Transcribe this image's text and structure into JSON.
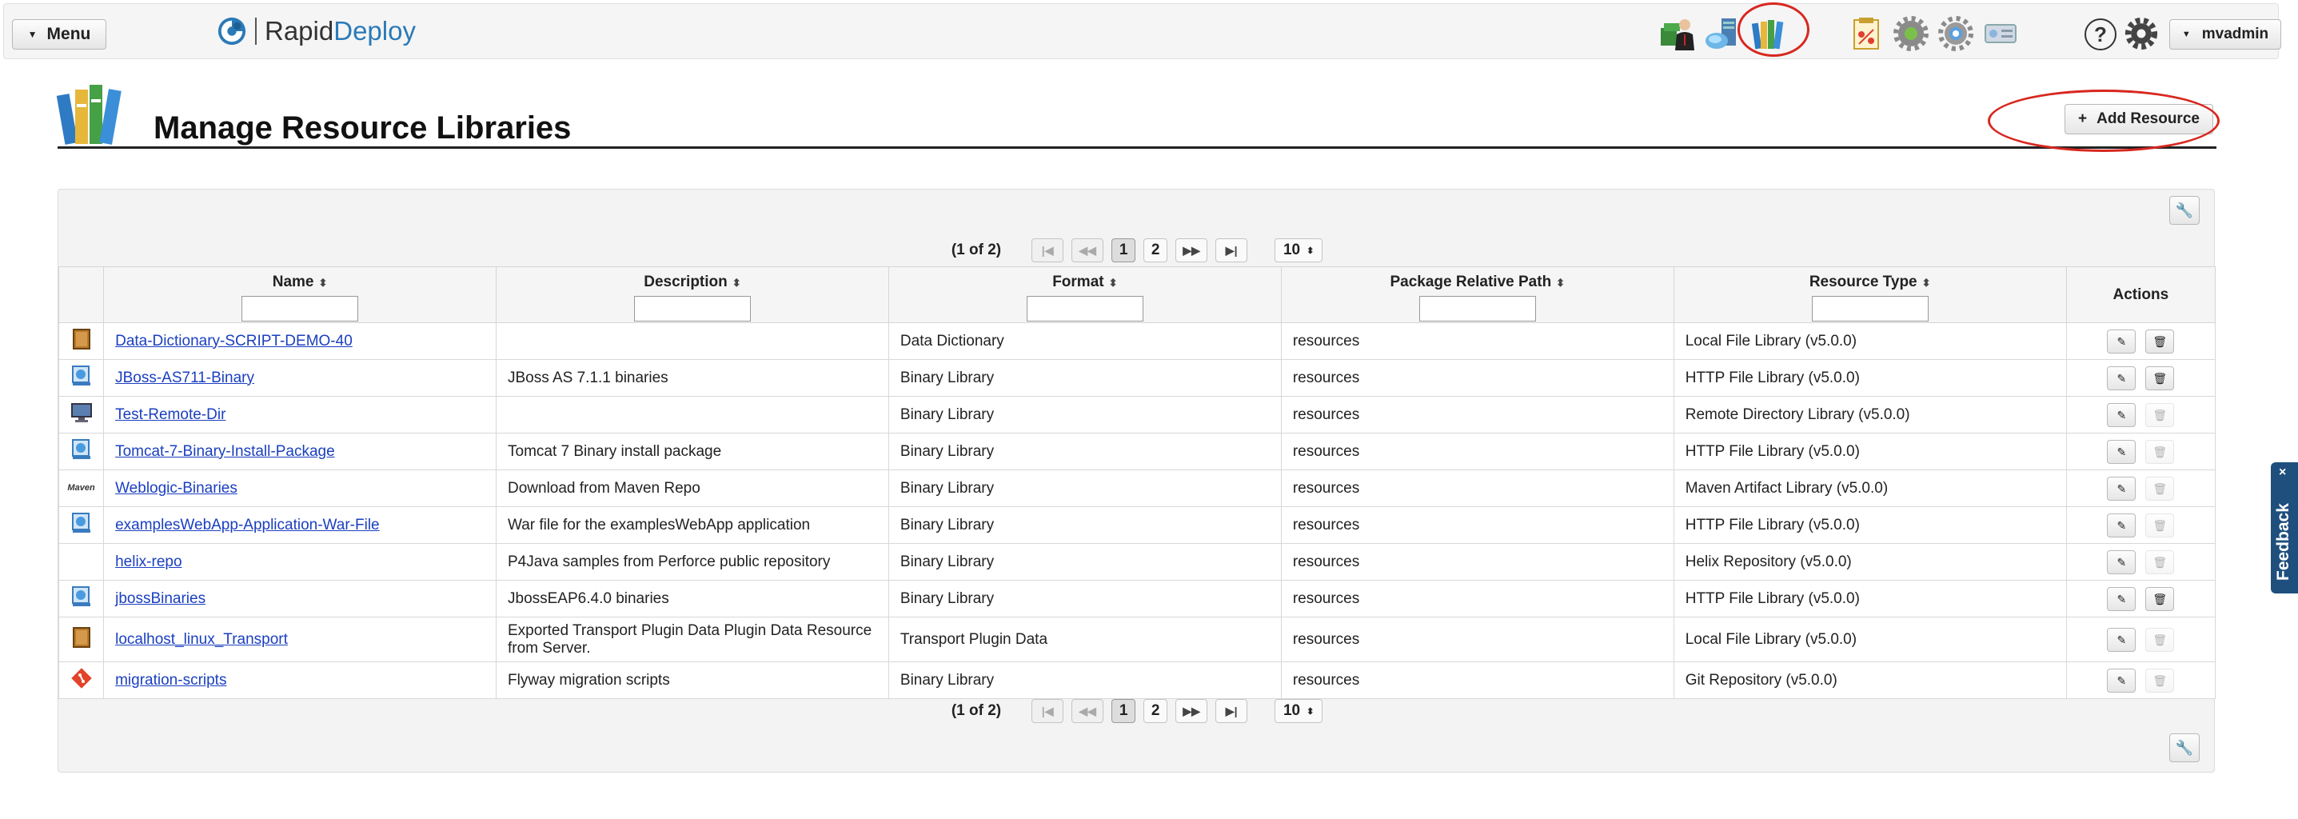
{
  "header": {
    "menu_label": "Menu",
    "brand_part1": "Rapid",
    "brand_part2": "Deploy",
    "help_glyph": "?",
    "user_label": "mvadmin",
    "toolbar_icons": [
      "environments-icon",
      "servers-icon",
      "resource-libraries-icon",
      "jobs-icon",
      "plugins-icon",
      "settings-cog-icon",
      "server-status-icon"
    ]
  },
  "page": {
    "title": "Manage Resource Libraries",
    "add_button": "Add Resource",
    "add_button_glyph": "+"
  },
  "pagination": {
    "count": "(1 of 2)",
    "first": "|◀",
    "prev": "◀◀",
    "pages": [
      "1",
      "2"
    ],
    "next": "▶▶",
    "last": "▶|",
    "rows_per_page": "10",
    "active_page": "1"
  },
  "table": {
    "columns": [
      "Name",
      "Description",
      "Format",
      "Package Relative Path",
      "Resource Type",
      "Actions"
    ],
    "rows": [
      {
        "icon": "local-file-library-icon",
        "name": "Data-Dictionary-SCRIPT-DEMO-40",
        "description": "",
        "format": "Data Dictionary",
        "path": "resources",
        "type": "Local File Library (v5.0.0)",
        "delete_enabled": true
      },
      {
        "icon": "http-file-library-icon",
        "name": "JBoss-AS711-Binary",
        "description": "JBoss AS 7.1.1 binaries",
        "format": "Binary Library",
        "path": "resources",
        "type": "HTTP File Library (v5.0.0)",
        "delete_enabled": true
      },
      {
        "icon": "remote-directory-icon",
        "name": "Test-Remote-Dir",
        "description": "",
        "format": "Binary Library",
        "path": "resources",
        "type": "Remote Directory Library (v5.0.0)",
        "delete_enabled": false
      },
      {
        "icon": "http-file-library-icon",
        "name": "Tomcat-7-Binary-Install-Package",
        "description": "Tomcat 7 Binary install package",
        "format": "Binary Library",
        "path": "resources",
        "type": "HTTP File Library (v5.0.0)",
        "delete_enabled": false
      },
      {
        "icon": "maven-icon",
        "name": "Weblogic-Binaries",
        "description": "Download from Maven Repo",
        "format": "Binary Library",
        "path": "resources",
        "type": "Maven Artifact Library (v5.0.0)",
        "delete_enabled": false
      },
      {
        "icon": "http-file-library-icon",
        "name": "examplesWebApp-Application-War-File",
        "description": "War file for the examplesWebApp application",
        "format": "Binary Library",
        "path": "resources",
        "type": "HTTP File Library (v5.0.0)",
        "delete_enabled": false
      },
      {
        "icon": "",
        "name": "helix-repo",
        "description": "P4Java samples from Perforce public repository",
        "format": "Binary Library",
        "path": "resources",
        "type": "Helix Repository (v5.0.0)",
        "delete_enabled": false
      },
      {
        "icon": "http-file-library-icon",
        "name": "jbossBinaries",
        "description": "JbossEAP6.4.0 binaries",
        "format": "Binary Library",
        "path": "resources",
        "type": "HTTP File Library (v5.0.0)",
        "delete_enabled": true
      },
      {
        "icon": "local-file-library-icon",
        "name": "localhost_linux_Transport",
        "description": "Exported Transport Plugin Data Plugin Data Resource from Server.",
        "format": "Transport Plugin Data",
        "path": "resources",
        "type": "Local File Library (v5.0.0)",
        "delete_enabled": false
      },
      {
        "icon": "git-icon",
        "name": "migration-scripts",
        "description": "Flyway migration scripts",
        "format": "Binary Library",
        "path": "resources",
        "type": "Git Repository (v5.0.0)",
        "delete_enabled": false
      }
    ]
  },
  "feedback": {
    "label": "Feedback",
    "close": "×"
  },
  "maven_text": "Maven",
  "colors": {
    "link": "#1a3fbf",
    "annotation": "#d8271f",
    "feedback_bg": "#1e4f7d",
    "brand_accent": "#2a7ab8"
  }
}
